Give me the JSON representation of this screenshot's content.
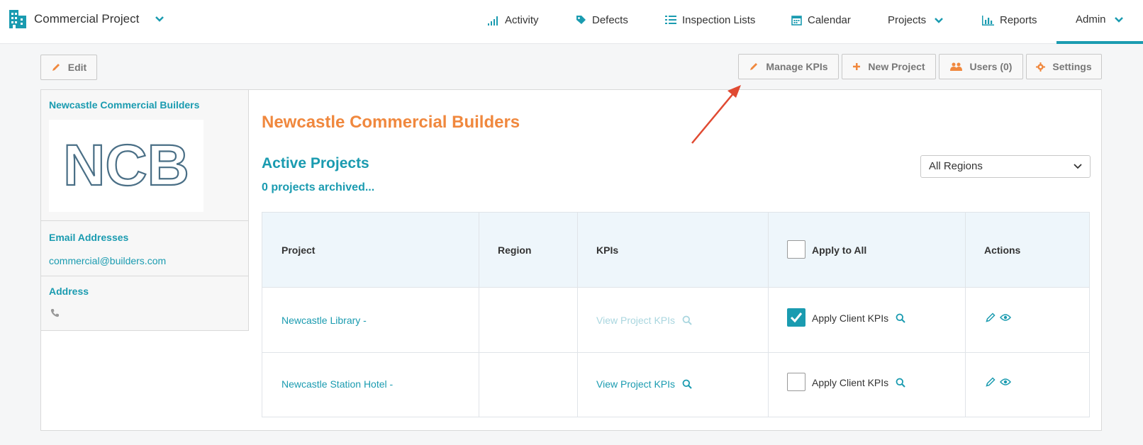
{
  "brand": {
    "title": "Commercial Project"
  },
  "nav": {
    "activity": "Activity",
    "defects": "Defects",
    "inspection_lists": "Inspection Lists",
    "calendar": "Calendar",
    "projects": "Projects",
    "reports": "Reports",
    "admin": "Admin"
  },
  "toolbar": {
    "edit": "Edit",
    "manage_kpis": "Manage KPIs",
    "new_project": "New Project",
    "users": "Users (0)",
    "settings": "Settings"
  },
  "sidebar": {
    "company_name": "Newcastle Commercial Builders",
    "logo_text": "NCB",
    "email_heading": "Email Addresses",
    "email": "commercial@builders.com",
    "address_heading": "Address"
  },
  "main": {
    "company_title": "Newcastle Commercial Builders",
    "active_heading": "Active Projects",
    "archived_link": "0 projects archived...",
    "region_select": "All Regions"
  },
  "table": {
    "headers": {
      "project": "Project",
      "region": "Region",
      "kpis": "KPIs",
      "apply_all": "Apply to All",
      "actions": "Actions"
    },
    "rows": [
      {
        "project": "Newcastle Library -",
        "region": "",
        "kpi_link": "View Project KPIs",
        "apply": "Apply Client KPIs",
        "checked": true
      },
      {
        "project": "Newcastle Station Hotel -",
        "region": "",
        "kpi_link": "View Project KPIs",
        "apply": "Apply Client KPIs",
        "checked": false
      }
    ]
  },
  "colors": {
    "accent": "#1a9bb0",
    "orange": "#f0883e",
    "annotation": "#e04a32"
  }
}
